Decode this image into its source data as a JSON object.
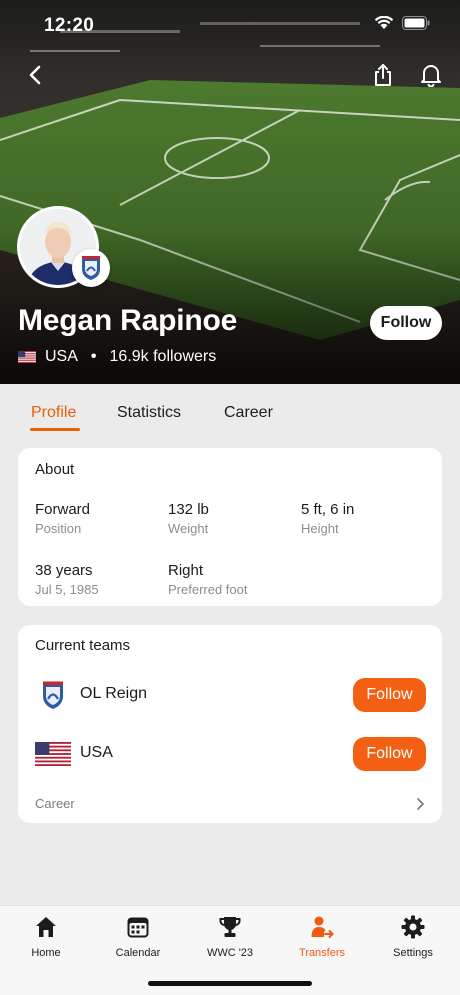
{
  "status_bar": {
    "time": "12:20"
  },
  "player": {
    "name": "Megan Rapinoe",
    "country": "USA",
    "followers": "16.9k followers",
    "follow_label": "Follow"
  },
  "tabs": [
    {
      "label": "Profile",
      "active": true
    },
    {
      "label": "Statistics",
      "active": false
    },
    {
      "label": "Career",
      "active": false
    }
  ],
  "about": {
    "title": "About",
    "stats": [
      {
        "value": "Forward",
        "label": "Position"
      },
      {
        "value": "132 lb",
        "label": "Weight"
      },
      {
        "value": "5 ft, 6 in",
        "label": "Height"
      },
      {
        "value": "38 years",
        "label": "Jul 5, 1985"
      },
      {
        "value": "Right",
        "label": "Preferred foot"
      }
    ]
  },
  "current_teams": {
    "title": "Current teams",
    "teams": [
      {
        "name": "OL Reign",
        "follow_label": "Follow",
        "logo": "ol-reign-crest"
      },
      {
        "name": "USA",
        "follow_label": "Follow",
        "logo": "usa-flag"
      }
    ],
    "career_link": "Career"
  },
  "bottom_nav": [
    {
      "label": "Home",
      "icon": "home-icon",
      "active": false
    },
    {
      "label": "Calendar",
      "icon": "calendar-icon",
      "active": false
    },
    {
      "label": "WWC '23",
      "icon": "trophy-icon",
      "active": false
    },
    {
      "label": "Transfers",
      "icon": "transfers-icon",
      "active": true
    },
    {
      "label": "Settings",
      "icon": "settings-icon",
      "active": false
    }
  ],
  "colors": {
    "accent": "#f36014",
    "accent_text": "#e8600a",
    "background": "#ebebeb",
    "card": "#ffffff"
  }
}
